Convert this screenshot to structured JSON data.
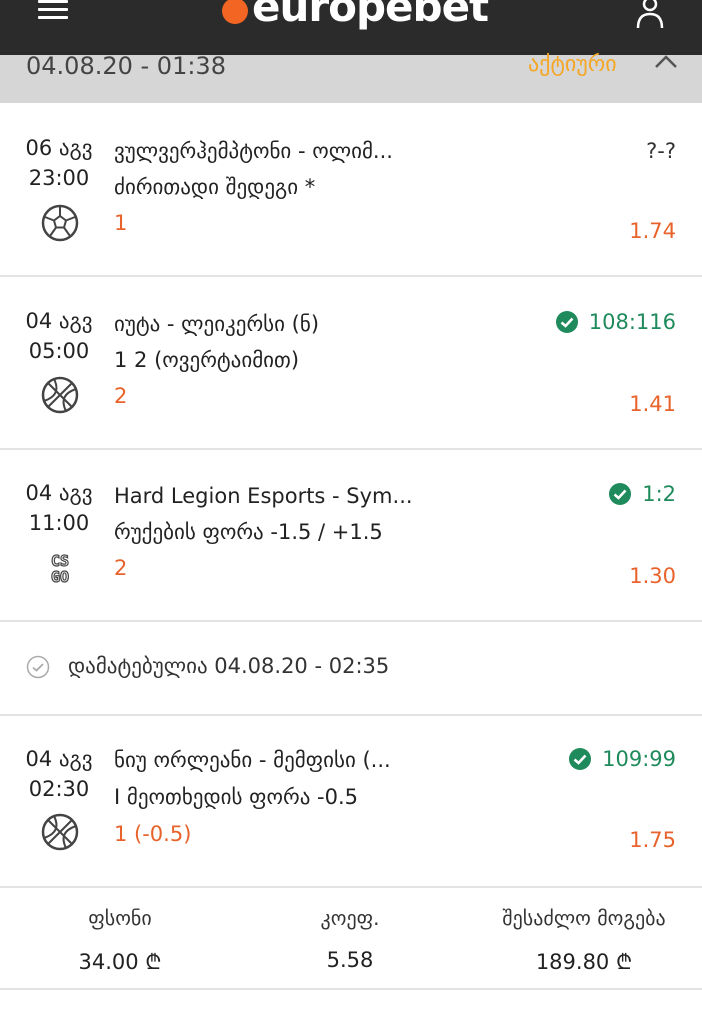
{
  "header": {
    "logo_text": "europebet",
    "brand_color": "#f26522"
  },
  "ticket": {
    "date": "04.08.20 - 01:38",
    "status": "აქტიური",
    "status_color": "#f5a623"
  },
  "bets": [
    {
      "day": "06 აგვ",
      "time": "23:00",
      "sport_icon": "soccer-ball-icon",
      "match": "ვულვერჰემპტონი - ოლიმ...",
      "market": "ძირითადი შედეგი *",
      "pick": "1",
      "odds": "1.74",
      "score": "?-?",
      "settled": false
    },
    {
      "day": "04 აგვ",
      "time": "05:00",
      "sport_icon": "basketball-icon",
      "match": "იუტა - ლეიკერსი (ნ)",
      "market": "1 2 (ოვერტაიმით)",
      "pick": "2",
      "odds": "1.41",
      "score": "108:116",
      "settled": true
    },
    {
      "day": "04 აგვ",
      "time": "11:00",
      "sport_icon": "csgo-icon",
      "match": "Hard Legion Esports - Sym...",
      "market": "რუქების ფორა -1.5 / +1.5",
      "pick": "2",
      "odds": "1.30",
      "score": "1:2",
      "settled": true
    },
    {
      "day": "04 აგვ",
      "time": "02:30",
      "sport_icon": "basketball-icon",
      "match": "ნიუ ორლეანი - მემფისი (...",
      "market": "I მეოთხედის ფორა -0.5",
      "pick": "1 (-0.5)",
      "odds": "1.75",
      "score": "109:99",
      "settled": true
    }
  ],
  "added": {
    "text": "დამატებულია 04.08.20 - 02:35"
  },
  "summary": {
    "stake_label": "ფსონი",
    "stake_value": "34.00 ₾",
    "coef_label": "კოეფ.",
    "coef_value": "5.58",
    "win_label": "შესაძლო მოგება",
    "win_value": "189.80 ₾"
  },
  "colors": {
    "odds": "#e8632b",
    "win": "#1f8a5b"
  }
}
